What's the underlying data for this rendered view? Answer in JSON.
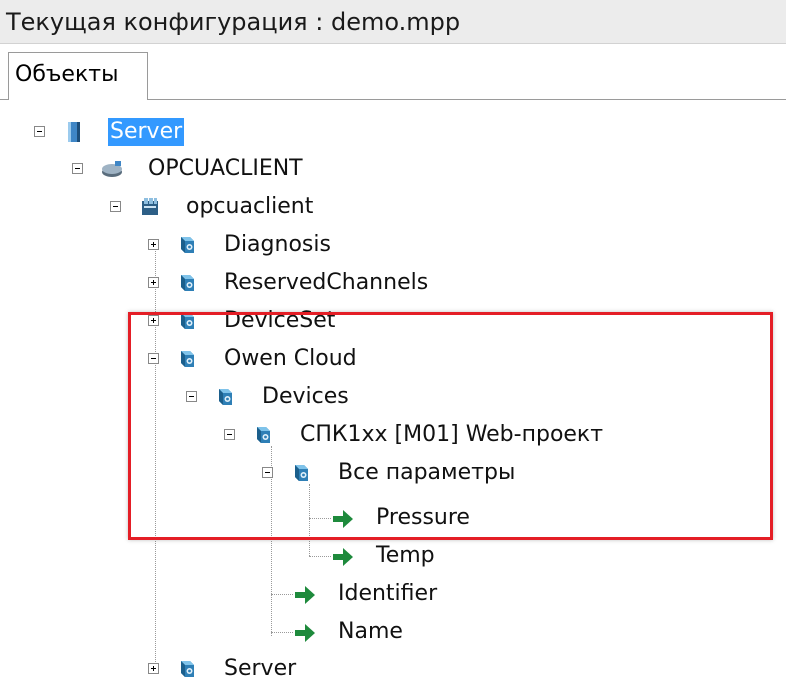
{
  "header": {
    "title": "Текущая конфигурация : demo.mpp"
  },
  "tabs": [
    {
      "label": "Объекты"
    }
  ],
  "tree": {
    "server": "Server",
    "opcuaclient_module": "OPCUACLIENT",
    "opcuaclient": "opcuaclient",
    "diagnosis": "Diagnosis",
    "reserved_channels": "ReservedChannels",
    "device_set": "DeviceSet",
    "owen_cloud": "Owen Cloud",
    "devices": "Devices",
    "spk_device": "СПК1xx [M01] Web-проект",
    "all_params": "Все параметры",
    "pressure": "Pressure",
    "temp": "Temp",
    "identifier": "Identifier",
    "name": "Name",
    "server_bottom": "Server"
  },
  "colors": {
    "selection": "#3399ff",
    "highlight_box": "#e41e26",
    "folder_icon": "#2e7fb6",
    "variable_arrow": "#1e8a3c"
  }
}
